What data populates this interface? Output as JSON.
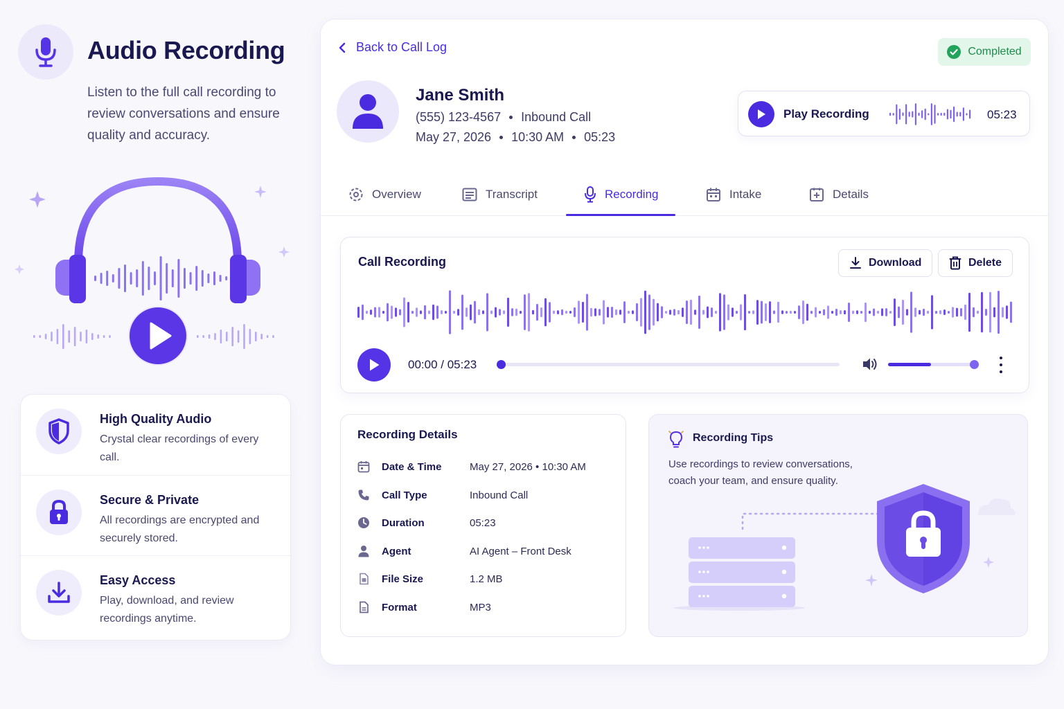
{
  "hero": {
    "title": "Audio Recording",
    "description": "Listen to the full call recording to review conversations and ensure quality and accuracy."
  },
  "features": [
    {
      "title": "High Quality Audio",
      "description": "Crystal clear recordings of every call.",
      "icon": "shield-icon"
    },
    {
      "title": "Secure & Private",
      "description": "All recordings are encrypted and securely stored.",
      "icon": "lock-icon"
    },
    {
      "title": "Easy Access",
      "description": "Play, download, and review recordings anytime.",
      "icon": "download-tray-icon"
    }
  ],
  "header": {
    "back_label": "Back to Call Log",
    "status": "Completed"
  },
  "contact": {
    "name": "Jane Smith",
    "phone": "(555) 123-4567",
    "call_kind": "Inbound Call",
    "date": "May 27, 2026",
    "time": "10:30 AM",
    "duration": "05:23"
  },
  "quick_play": {
    "label": "Play Recording",
    "duration": "05:23"
  },
  "tabs": [
    {
      "label": "Overview",
      "icon": "overview-icon",
      "active": false
    },
    {
      "label": "Transcript",
      "icon": "transcript-icon",
      "active": false
    },
    {
      "label": "Recording",
      "icon": "microphone-icon",
      "active": true
    },
    {
      "label": "Intake",
      "icon": "calendar-icon",
      "active": false
    },
    {
      "label": "Details",
      "icon": "details-icon",
      "active": false
    }
  ],
  "player": {
    "title": "Call Recording",
    "download_label": "Download",
    "delete_label": "Delete",
    "time_display": "00:00 / 05:23",
    "progress": 0,
    "volume": 0.5
  },
  "recording_details": {
    "title": "Recording Details",
    "rows": [
      {
        "label": "Date & Time",
        "value": "May 27, 2026  •  10:30 AM",
        "icon": "calendar-icon"
      },
      {
        "label": "Call Type",
        "value": "Inbound Call",
        "icon": "phone-icon"
      },
      {
        "label": "Duration",
        "value": "05:23",
        "icon": "clock-icon"
      },
      {
        "label": "Agent",
        "value": "AI Agent – Front Desk",
        "icon": "person-icon"
      },
      {
        "label": "File Size",
        "value": "1.2 MB",
        "icon": "file-size-icon"
      },
      {
        "label": "Format",
        "value": "MP3",
        "icon": "file-icon"
      }
    ]
  },
  "tips": {
    "title": "Recording Tips",
    "description": "Use recordings to review conversations, coach your team, and ensure quality."
  },
  "colors": {
    "accent": "#4b2be0",
    "accent_light": "#8b73f0",
    "success_bg": "#e2f6ea",
    "success_text": "#1d8a4a"
  }
}
